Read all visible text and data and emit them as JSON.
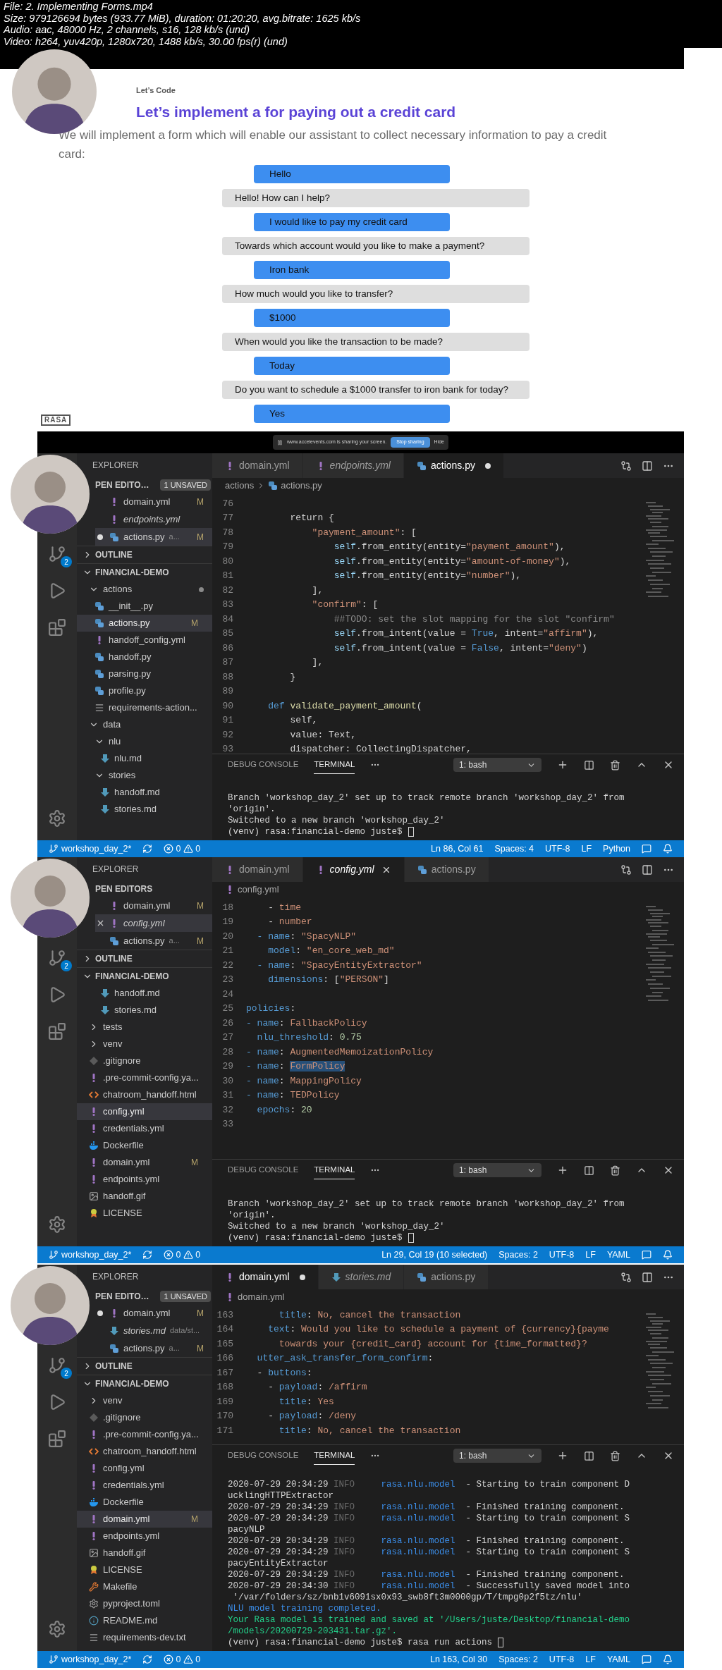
{
  "file_info": [
    "File: 2. Implementing Forms.mp4",
    "Size: 979126694 bytes (933.77 MiB), duration: 01:20:20, avg.bitrate: 1625 kb/s",
    "Audio: aac, 48000 Hz, 2 channels, s16, 128 kb/s (und)",
    "Video: h264, yuv420p, 1280x720, 1488 kb/s, 30.00 fps(r) (und)"
  ],
  "frames": [
    {
      "kind": "slide",
      "eyebrow": "Let’s Code",
      "title": "Let’s implement a for paying out a credit card",
      "intro": "We will implement a form which will enable our assistant to collect necessary information to pay a credit card:",
      "logo": "RASA",
      "messages": [
        {
          "kind": "user",
          "text": "Hello"
        },
        {
          "kind": "bot",
          "text": "Hello! How can I help?"
        },
        {
          "kind": "user",
          "text": "I would like to pay my credit card"
        },
        {
          "kind": "bot",
          "text": "Towards which account would you like to make a payment?"
        },
        {
          "kind": "user",
          "text": "Iron bank"
        },
        {
          "kind": "bot",
          "text": "How much would you like to transfer?"
        },
        {
          "kind": "user",
          "text": "$1000"
        },
        {
          "kind": "bot",
          "text": "When would you like the transaction to be made?"
        },
        {
          "kind": "user",
          "text": "Today"
        },
        {
          "kind": "bot",
          "text": "Do you want to schedule a $1000 transfer to iron bank for today?"
        },
        {
          "kind": "user",
          "text": "Yes"
        }
      ]
    },
    {
      "kind": "editor",
      "share_bar": {
        "message": "www.accelevents.com is sharing your screen.",
        "stop": "Stop sharing",
        "hide": "Hide"
      },
      "explorer": "EXPLORER",
      "scm_badge": "2",
      "open_editors": {
        "title": "PEN EDITO…",
        "badge": "1 UNSAVED",
        "items": [
          {
            "name": "domain.yml",
            "kind": "yml",
            "italic": false,
            "badge": "M",
            "dirty": false,
            "selected": false,
            "closable": false
          },
          {
            "name": "endpoints.yml",
            "kind": "yml",
            "italic": true,
            "dirty": false,
            "selected": false,
            "closable": false
          },
          {
            "name": "actions.py",
            "kind": "py",
            "italic": false,
            "detail": "a...",
            "badge": "M",
            "dirty": true,
            "selected": true,
            "closable": false
          }
        ]
      },
      "outline": {
        "title": "OUTLINE",
        "expanded": false
      },
      "project": {
        "title": "FINANCIAL-DEMO",
        "expanded": true,
        "tree": [
          {
            "name": "actions",
            "kind": "folder",
            "expanded": true,
            "selected": false,
            "dirty": true,
            "children": [
              {
                "name": "__init__.py",
                "kind": "py",
                "selected": false
              },
              {
                "name": "actions.py",
                "kind": "py",
                "selected": true,
                "badge": "M"
              },
              {
                "name": "handoff_config.yml",
                "kind": "yml",
                "selected": false
              },
              {
                "name": "handoff.py",
                "kind": "py",
                "selected": false
              },
              {
                "name": "parsing.py",
                "kind": "py",
                "selected": false
              },
              {
                "name": "profile.py",
                "kind": "py",
                "selected": false
              },
              {
                "name": "requirements-action...",
                "kind": "lines",
                "selected": false
              }
            ]
          },
          {
            "name": "data",
            "kind": "folder",
            "expanded": true,
            "selected": false,
            "children": [
              {
                "name": "nlu",
                "kind": "folder",
                "expanded": true,
                "selected": false,
                "children": [
                  {
                    "name": "nlu.md",
                    "kind": "md",
                    "selected": false
                  }
                ]
              },
              {
                "name": "stories",
                "kind": "folder",
                "expanded": true,
                "selected": false,
                "children": [
                  {
                    "name": "handoff.md",
                    "kind": "md",
                    "selected": false
                  },
                  {
                    "name": "stories.md",
                    "kind": "md",
                    "selected": false
                  }
                ]
              }
            ]
          }
        ]
      },
      "tabs": [
        {
          "name": "domain.yml",
          "kind": "yml",
          "italic": false,
          "selected": false,
          "dirty": false,
          "closable": false
        },
        {
          "name": "endpoints.yml",
          "kind": "yml",
          "italic": true,
          "selected": false,
          "dirty": false,
          "closable": false
        },
        {
          "name": "actions.py",
          "kind": "py",
          "italic": false,
          "selected": true,
          "dirty": true,
          "closable": false
        }
      ],
      "breadcrumb": [
        {
          "name": "actions",
          "kind": "folder"
        },
        {
          "name": "actions.py",
          "kind": "py"
        }
      ],
      "code": [
        {
          "num": "76"
        },
        {
          "num": "77",
          "tokens": [
            {
              "kind": "plain",
              "text": "        return {"
            }
          ]
        },
        {
          "num": "78",
          "tokens": [
            {
              "kind": "string",
              "text": "            \"payment_amount\""
            },
            {
              "kind": "plain",
              "text": ": ["
            }
          ]
        },
        {
          "num": "79",
          "tokens": [
            {
              "kind": "self",
              "text": "                self"
            },
            {
              "kind": "plain",
              "text": ".from_entity(entity="
            },
            {
              "kind": "string",
              "text": "\"payment_amount\""
            },
            {
              "kind": "plain",
              "text": "),"
            }
          ]
        },
        {
          "num": "80",
          "tokens": [
            {
              "kind": "self",
              "text": "                self"
            },
            {
              "kind": "plain",
              "text": ".from_entity(entity="
            },
            {
              "kind": "string",
              "text": "\"amount-of-money\""
            },
            {
              "kind": "plain",
              "text": "),"
            }
          ]
        },
        {
          "num": "81",
          "tokens": [
            {
              "kind": "self",
              "text": "                self"
            },
            {
              "kind": "plain",
              "text": ".from_entity(entity="
            },
            {
              "kind": "string",
              "text": "\"number\""
            },
            {
              "kind": "plain",
              "text": "),"
            }
          ]
        },
        {
          "num": "82",
          "tokens": [
            {
              "kind": "plain",
              "text": "            ],"
            }
          ]
        },
        {
          "num": "83",
          "tokens": [
            {
              "kind": "string",
              "text": "            \"confirm\""
            },
            {
              "kind": "plain",
              "text": ": ["
            }
          ]
        },
        {
          "num": "84",
          "tokens": [
            {
              "kind": "comment",
              "text": "                ##TODO: set the slot mapping for the slot \"confirm\""
            }
          ]
        },
        {
          "num": "85",
          "tokens": [
            {
              "kind": "self",
              "text": "                self"
            },
            {
              "kind": "plain",
              "text": ".from_intent(value = "
            },
            {
              "kind": "constant",
              "text": "True"
            },
            {
              "kind": "plain",
              "text": ", intent="
            },
            {
              "kind": "string",
              "text": "\"affirm\""
            },
            {
              "kind": "plain",
              "text": "),"
            }
          ]
        },
        {
          "num": "86",
          "tokens": [
            {
              "kind": "self",
              "text": "                self"
            },
            {
              "kind": "plain",
              "text": ".from_intent(value = "
            },
            {
              "kind": "constant",
              "text": "False"
            },
            {
              "kind": "plain",
              "text": ", intent="
            },
            {
              "kind": "string",
              "text": "\"deny\""
            },
            {
              "kind": "plain",
              "text": ")"
            }
          ]
        },
        {
          "num": "87",
          "tokens": [
            {
              "kind": "plain",
              "text": "            ],"
            }
          ]
        },
        {
          "num": "88",
          "tokens": [
            {
              "kind": "plain",
              "text": "        }"
            }
          ]
        },
        {
          "num": "89"
        },
        {
          "num": "90",
          "tokens": [
            {
              "kind": "keyword",
              "text": "    def"
            },
            {
              "kind": "function",
              "text": " validate_payment_amount"
            },
            {
              "kind": "plain",
              "text": "("
            }
          ]
        },
        {
          "num": "91",
          "tokens": [
            {
              "kind": "plain",
              "text": "        self,"
            }
          ]
        },
        {
          "num": "92",
          "tokens": [
            {
              "kind": "plain",
              "text": "        value: Text,"
            }
          ]
        },
        {
          "num": "93",
          "tokens": [
            {
              "kind": "plain",
              "text": "        dispatcher: CollectingDispatcher,"
            }
          ]
        }
      ],
      "panel_tabs": [
        {
          "label": "DEBUG CONSOLE",
          "selected": false
        },
        {
          "label": "TERMINAL",
          "selected": true
        }
      ],
      "shell": "1: bash",
      "terminal": [
        {
          "kind": "output",
          "tokens": [
            {
              "kind": "plain",
              "text": "Branch 'workshop_day_2' set up to track remote branch 'workshop_day_2' from"
            }
          ]
        },
        {
          "kind": "output",
          "tokens": [
            {
              "kind": "plain",
              "text": "'origin'."
            }
          ]
        },
        {
          "kind": "output",
          "tokens": [
            {
              "kind": "plain",
              "text": "Switched to a new branch 'workshop_day_2'"
            }
          ]
        },
        {
          "kind": "prompt",
          "tokens": [
            {
              "kind": "plain",
              "text": "(venv) rasa:financial-demo juste$"
            }
          ]
        }
      ],
      "status": {
        "branch": "workshop_day_2*",
        "errors": "0",
        "warnings": "0",
        "items": [
          "Ln 86, Col 61",
          "Spaces: 4",
          "UTF-8",
          "LF",
          "Python"
        ]
      }
    },
    {
      "kind": "editor",
      "explorer": "EXPLORER",
      "scm_badge": "2",
      "open_editors": {
        "title": "PEN EDITORS",
        "items": [
          {
            "name": "domain.yml",
            "kind": "yml",
            "italic": false,
            "badge": "M",
            "dirty": false,
            "selected": false,
            "closable": false
          },
          {
            "name": "config.yml",
            "kind": "yml",
            "italic": true,
            "dirty": false,
            "selected": true,
            "closable": true
          },
          {
            "name": "actions.py",
            "kind": "py",
            "italic": false,
            "detail": "a...",
            "badge": "M",
            "dirty": false,
            "selected": false,
            "closable": false
          }
        ]
      },
      "outline": {
        "title": "OUTLINE",
        "expanded": false
      },
      "project": {
        "title": "FINANCIAL-DEMO",
        "expanded": true,
        "tree": [
          {
            "children": [
              {
                "children": [
                  {
                    "name": "handoff.md",
                    "kind": "md",
                    "selected": false
                  },
                  {
                    "name": "stories.md",
                    "kind": "md",
                    "selected": false
                  }
                ]
              }
            ]
          },
          {
            "name": "tests",
            "kind": "folder",
            "expanded": false,
            "selected": false
          },
          {
            "name": "venv",
            "kind": "folder",
            "expanded": false,
            "selected": false
          },
          {
            "name": ".gitignore",
            "kind": "git",
            "selected": false
          },
          {
            "name": ".pre-commit-config.ya...",
            "kind": "yml",
            "selected": false
          },
          {
            "name": "chatroom_handoff.html",
            "kind": "html",
            "selected": false
          },
          {
            "name": "config.yml",
            "kind": "yml",
            "selected": true
          },
          {
            "name": "credentials.yml",
            "kind": "yml",
            "selected": false
          },
          {
            "name": "Dockerfile",
            "kind": "docker",
            "selected": false
          },
          {
            "name": "domain.yml",
            "kind": "yml",
            "selected": false,
            "badge": "M"
          },
          {
            "name": "endpoints.yml",
            "kind": "yml",
            "selected": false
          },
          {
            "name": "handoff.gif",
            "kind": "gif",
            "selected": false
          },
          {
            "name": "LICENSE",
            "kind": "license",
            "selected": false
          }
        ]
      },
      "tabs": [
        {
          "name": "domain.yml",
          "kind": "yml",
          "italic": false,
          "selected": false,
          "dirty": false,
          "closable": false
        },
        {
          "name": "config.yml",
          "kind": "yml",
          "italic": true,
          "selected": true,
          "dirty": false,
          "closable": true
        },
        {
          "name": "actions.py",
          "kind": "py",
          "italic": false,
          "selected": false,
          "dirty": false,
          "closable": false
        }
      ],
      "breadcrumb": [
        {
          "name": "config.yml",
          "kind": "yml"
        }
      ],
      "code": [
        {
          "num": "18",
          "tokens": [
            {
              "kind": "plain",
              "text": "    - "
            },
            {
              "kind": "string",
              "text": "time"
            }
          ]
        },
        {
          "num": "19",
          "tokens": [
            {
              "kind": "plain",
              "text": "    - "
            },
            {
              "kind": "string",
              "text": "number"
            }
          ]
        },
        {
          "num": "20",
          "tokens": [
            {
              "kind": "key",
              "text": "  - name"
            },
            {
              "kind": "plain",
              "text": ": "
            },
            {
              "kind": "string",
              "text": "\"SpacyNLP\""
            }
          ]
        },
        {
          "num": "21",
          "tokens": [
            {
              "kind": "key",
              "text": "    model"
            },
            {
              "kind": "plain",
              "text": ": "
            },
            {
              "kind": "string",
              "text": "\"en_core_web_md\""
            }
          ]
        },
        {
          "num": "22",
          "tokens": [
            {
              "kind": "key",
              "text": "  - name"
            },
            {
              "kind": "plain",
              "text": ": "
            },
            {
              "kind": "string",
              "text": "\"SpacyEntityExtractor\""
            }
          ]
        },
        {
          "num": "23",
          "tokens": [
            {
              "kind": "key",
              "text": "    dimensions"
            },
            {
              "kind": "plain",
              "text": ": ["
            },
            {
              "kind": "string",
              "text": "\"PERSON\""
            },
            {
              "kind": "plain",
              "text": "]"
            }
          ]
        },
        {
          "num": "24"
        },
        {
          "num": "25",
          "tokens": [
            {
              "kind": "key",
              "text": "policies"
            },
            {
              "kind": "plain",
              "text": ":"
            }
          ]
        },
        {
          "num": "26",
          "tokens": [
            {
              "kind": "key",
              "text": "- name"
            },
            {
              "kind": "plain",
              "text": ": "
            },
            {
              "kind": "string",
              "text": "FallbackPolicy"
            }
          ]
        },
        {
          "num": "27",
          "tokens": [
            {
              "kind": "key",
              "text": "  nlu_threshold"
            },
            {
              "kind": "plain",
              "text": ": "
            },
            {
              "kind": "number",
              "text": "0.75"
            }
          ]
        },
        {
          "num": "28",
          "tokens": [
            {
              "kind": "key",
              "text": "- name"
            },
            {
              "kind": "plain",
              "text": ": "
            },
            {
              "kind": "string",
              "text": "AugmentedMemoizationPolicy"
            }
          ]
        },
        {
          "num": "29",
          "tokens": [
            {
              "kind": "key",
              "text": "- name"
            },
            {
              "kind": "plain",
              "text": ": "
            },
            {
              "kind": "selected_string",
              "text": "FormPolicy"
            }
          ]
        },
        {
          "num": "30",
          "tokens": [
            {
              "kind": "key",
              "text": "- name"
            },
            {
              "kind": "plain",
              "text": ": "
            },
            {
              "kind": "string",
              "text": "MappingPolicy"
            }
          ]
        },
        {
          "num": "31",
          "tokens": [
            {
              "kind": "key",
              "text": "- name"
            },
            {
              "kind": "plain",
              "text": ": "
            },
            {
              "kind": "string",
              "text": "TEDPolicy"
            }
          ]
        },
        {
          "num": "32",
          "tokens": [
            {
              "kind": "key",
              "text": "  epochs"
            },
            {
              "kind": "plain",
              "text": ": "
            },
            {
              "kind": "number",
              "text": "20"
            }
          ]
        },
        {
          "num": "33"
        }
      ],
      "panel_tabs": [
        {
          "label": "DEBUG CONSOLE",
          "selected": false
        },
        {
          "label": "TERMINAL",
          "selected": true
        }
      ],
      "shell": "1: bash",
      "terminal": [
        {
          "kind": "output",
          "tokens": [
            {
              "kind": "plain",
              "text": "Branch 'workshop_day_2' set up to track remote branch 'workshop_day_2' from"
            }
          ]
        },
        {
          "kind": "output",
          "tokens": [
            {
              "kind": "plain",
              "text": "'origin'."
            }
          ]
        },
        {
          "kind": "output",
          "tokens": [
            {
              "kind": "plain",
              "text": "Switched to a new branch 'workshop_day_2'"
            }
          ]
        },
        {
          "kind": "prompt",
          "tokens": [
            {
              "kind": "plain",
              "text": "(venv) rasa:financial-demo juste$"
            }
          ]
        }
      ],
      "status": {
        "branch": "workshop_day_2*",
        "errors": "0",
        "warnings": "0",
        "items": [
          "Ln 29, Col 19 (10 selected)",
          "Spaces: 2",
          "UTF-8",
          "LF",
          "YAML"
        ]
      }
    },
    {
      "kind": "editor",
      "explorer": "EXPLORER",
      "scm_badge": "2",
      "open_editors": {
        "title": "PEN EDITO…",
        "badge": "1 UNSAVED",
        "items": [
          {
            "name": "domain.yml",
            "kind": "yml",
            "italic": false,
            "badge": "M",
            "dirty": true,
            "selected": false,
            "closable": false
          },
          {
            "name": "stories.md",
            "kind": "md",
            "italic": true,
            "detail": "data/st...",
            "dirty": false,
            "selected": false,
            "closable": false
          },
          {
            "name": "actions.py",
            "kind": "py",
            "italic": false,
            "detail": "a...",
            "badge": "M",
            "dirty": false,
            "selected": false,
            "closable": false
          }
        ]
      },
      "outline": {
        "title": "OUTLINE",
        "expanded": false
      },
      "project": {
        "title": "FINANCIAL-DEMO",
        "expanded": true,
        "tree": [
          {
            "name": "venv",
            "kind": "folder",
            "expanded": false,
            "selected": false
          },
          {
            "name": ".gitignore",
            "kind": "git",
            "selected": false
          },
          {
            "name": ".pre-commit-config.ya...",
            "kind": "yml",
            "selected": false
          },
          {
            "name": "chatroom_handoff.html",
            "kind": "html",
            "selected": false
          },
          {
            "name": "config.yml",
            "kind": "yml",
            "selected": false
          },
          {
            "name": "credentials.yml",
            "kind": "yml",
            "selected": false
          },
          {
            "name": "Dockerfile",
            "kind": "docker",
            "selected": false
          },
          {
            "name": "domain.yml",
            "kind": "yml",
            "selected": true,
            "badge": "M"
          },
          {
            "name": "endpoints.yml",
            "kind": "yml",
            "selected": false
          },
          {
            "name": "handoff.gif",
            "kind": "gif",
            "selected": false
          },
          {
            "name": "LICENSE",
            "kind": "license",
            "selected": false
          },
          {
            "name": "Makefile",
            "kind": "makefile",
            "selected": false
          },
          {
            "name": "pyproject.toml",
            "kind": "toml",
            "selected": false
          },
          {
            "name": "README.md",
            "kind": "info",
            "selected": false
          },
          {
            "name": "requirements-dev.txt",
            "kind": "lines",
            "selected": false
          }
        ]
      },
      "tabs": [
        {
          "name": "domain.yml",
          "kind": "yml",
          "italic": false,
          "selected": true,
          "dirty": true,
          "closable": false
        },
        {
          "name": "stories.md",
          "kind": "md",
          "italic": true,
          "selected": false,
          "dirty": false,
          "closable": false
        },
        {
          "name": "actions.py",
          "kind": "py",
          "italic": false,
          "selected": false,
          "dirty": false,
          "closable": false
        }
      ],
      "breadcrumb": [
        {
          "name": "domain.yml",
          "kind": "yml"
        }
      ],
      "code": [
        {
          "num": "163",
          "tokens": [
            {
              "kind": "key",
              "text": "      title"
            },
            {
              "kind": "plain",
              "text": ": "
            },
            {
              "kind": "string",
              "text": "No, cancel the transaction"
            }
          ]
        },
        {
          "num": "164",
          "tokens": [
            {
              "kind": "key",
              "text": "    text"
            },
            {
              "kind": "plain",
              "text": ": "
            },
            {
              "kind": "string",
              "text": "Would you like to schedule a payment of {currency}{payme"
            }
          ]
        },
        {
          "num": "165",
          "tokens": [
            {
              "kind": "string",
              "text": "      towards your {credit_card} account for {time_formatted}?"
            }
          ]
        },
        {
          "num": "166",
          "tokens": [
            {
              "kind": "key",
              "text": "  utter_ask_transfer_form_confirm"
            },
            {
              "kind": "plain",
              "text": ":"
            }
          ]
        },
        {
          "num": "167",
          "tokens": [
            {
              "kind": "plain",
              "text": "  - "
            },
            {
              "kind": "key",
              "text": "buttons"
            },
            {
              "kind": "plain",
              "text": ":"
            }
          ]
        },
        {
          "num": "168",
          "tokens": [
            {
              "kind": "plain",
              "text": "    - "
            },
            {
              "kind": "key",
              "text": "payload"
            },
            {
              "kind": "plain",
              "text": ": "
            },
            {
              "kind": "string",
              "text": "/affirm"
            }
          ]
        },
        {
          "num": "169",
          "tokens": [
            {
              "kind": "key",
              "text": "      title"
            },
            {
              "kind": "plain",
              "text": ": "
            },
            {
              "kind": "string",
              "text": "Yes"
            }
          ]
        },
        {
          "num": "170",
          "tokens": [
            {
              "kind": "plain",
              "text": "    - "
            },
            {
              "kind": "key",
              "text": "payload"
            },
            {
              "kind": "plain",
              "text": ": "
            },
            {
              "kind": "string",
              "text": "/deny"
            }
          ]
        },
        {
          "num": "171",
          "tokens": [
            {
              "kind": "key",
              "text": "      title"
            },
            {
              "kind": "plain",
              "text": ": "
            },
            {
              "kind": "string",
              "text": "No, cancel the transaction"
            }
          ]
        }
      ],
      "panel_tabs": [
        {
          "label": "DEBUG CONSOLE",
          "selected": false
        },
        {
          "label": "TERMINAL",
          "selected": true
        }
      ],
      "shell": "1: bash",
      "terminal": [
        {
          "kind": "output",
          "tokens": [
            {
              "kind": "plain",
              "text": "2020-07-29 20:34:29 "
            },
            {
              "kind": "dim",
              "text": "INFO"
            },
            {
              "kind": "logger",
              "text": "     rasa.nlu.model"
            },
            {
              "kind": "plain",
              "text": "  - Starting to train component D"
            }
          ]
        },
        {
          "kind": "output",
          "tokens": [
            {
              "kind": "plain",
              "text": "ucklingHTTPExtractor"
            }
          ]
        },
        {
          "kind": "output",
          "tokens": [
            {
              "kind": "plain",
              "text": "2020-07-29 20:34:29 "
            },
            {
              "kind": "dim",
              "text": "INFO"
            },
            {
              "kind": "logger",
              "text": "     rasa.nlu.model"
            },
            {
              "kind": "plain",
              "text": "  - Finished training component."
            }
          ]
        },
        {
          "kind": "output",
          "tokens": [
            {
              "kind": "plain",
              "text": "2020-07-29 20:34:29 "
            },
            {
              "kind": "dim",
              "text": "INFO"
            },
            {
              "kind": "logger",
              "text": "     rasa.nlu.model"
            },
            {
              "kind": "plain",
              "text": "  - Starting to train component S"
            }
          ]
        },
        {
          "kind": "output",
          "tokens": [
            {
              "kind": "plain",
              "text": "pacyNLP"
            }
          ]
        },
        {
          "kind": "output",
          "tokens": [
            {
              "kind": "plain",
              "text": "2020-07-29 20:34:29 "
            },
            {
              "kind": "dim",
              "text": "INFO"
            },
            {
              "kind": "logger",
              "text": "     rasa.nlu.model"
            },
            {
              "kind": "plain",
              "text": "  - Finished training component."
            }
          ]
        },
        {
          "kind": "output",
          "tokens": [
            {
              "kind": "plain",
              "text": "2020-07-29 20:34:29 "
            },
            {
              "kind": "dim",
              "text": "INFO"
            },
            {
              "kind": "logger",
              "text": "     rasa.nlu.model"
            },
            {
              "kind": "plain",
              "text": "  - Starting to train component S"
            }
          ]
        },
        {
          "kind": "output",
          "tokens": [
            {
              "kind": "plain",
              "text": "pacyEntityExtractor"
            }
          ]
        },
        {
          "kind": "output",
          "tokens": [
            {
              "kind": "plain",
              "text": "2020-07-29 20:34:29 "
            },
            {
              "kind": "dim",
              "text": "INFO"
            },
            {
              "kind": "logger",
              "text": "     rasa.nlu.model"
            },
            {
              "kind": "plain",
              "text": "  - Finished training component."
            }
          ]
        },
        {
          "kind": "output",
          "tokens": [
            {
              "kind": "plain",
              "text": "2020-07-29 20:34:30 "
            },
            {
              "kind": "dim",
              "text": "INFO"
            },
            {
              "kind": "logger",
              "text": "     rasa.nlu.model"
            },
            {
              "kind": "plain",
              "text": "  - Successfully saved model into"
            }
          ]
        },
        {
          "kind": "output",
          "tokens": [
            {
              "kind": "plain",
              "text": " '/var/folders/sz/bnb1v6091sx0x93_swb8ft3m0000gp/T/tmpg0p2f5tz/nlu'"
            }
          ]
        },
        {
          "kind": "output",
          "tokens": [
            {
              "kind": "info",
              "text": "NLU model training completed."
            }
          ]
        },
        {
          "kind": "output",
          "tokens": [
            {
              "kind": "success",
              "text": "Your Rasa model is trained and saved at '/Users/juste/Desktop/financial-demo"
            }
          ]
        },
        {
          "kind": "output",
          "tokens": [
            {
              "kind": "success",
              "text": "/models/20200729-203431.tar.gz'."
            }
          ]
        },
        {
          "kind": "prompt",
          "tokens": [
            {
              "kind": "plain",
              "text": "(venv) rasa:financial-demo juste$ rasa run actions"
            }
          ]
        }
      ],
      "status": {
        "branch": "workshop_day_2*",
        "errors": "0",
        "warnings": "0",
        "items": [
          "Ln 163, Col 30",
          "Spaces: 2",
          "UTF-8",
          "LF",
          "YAML"
        ]
      }
    }
  ]
}
